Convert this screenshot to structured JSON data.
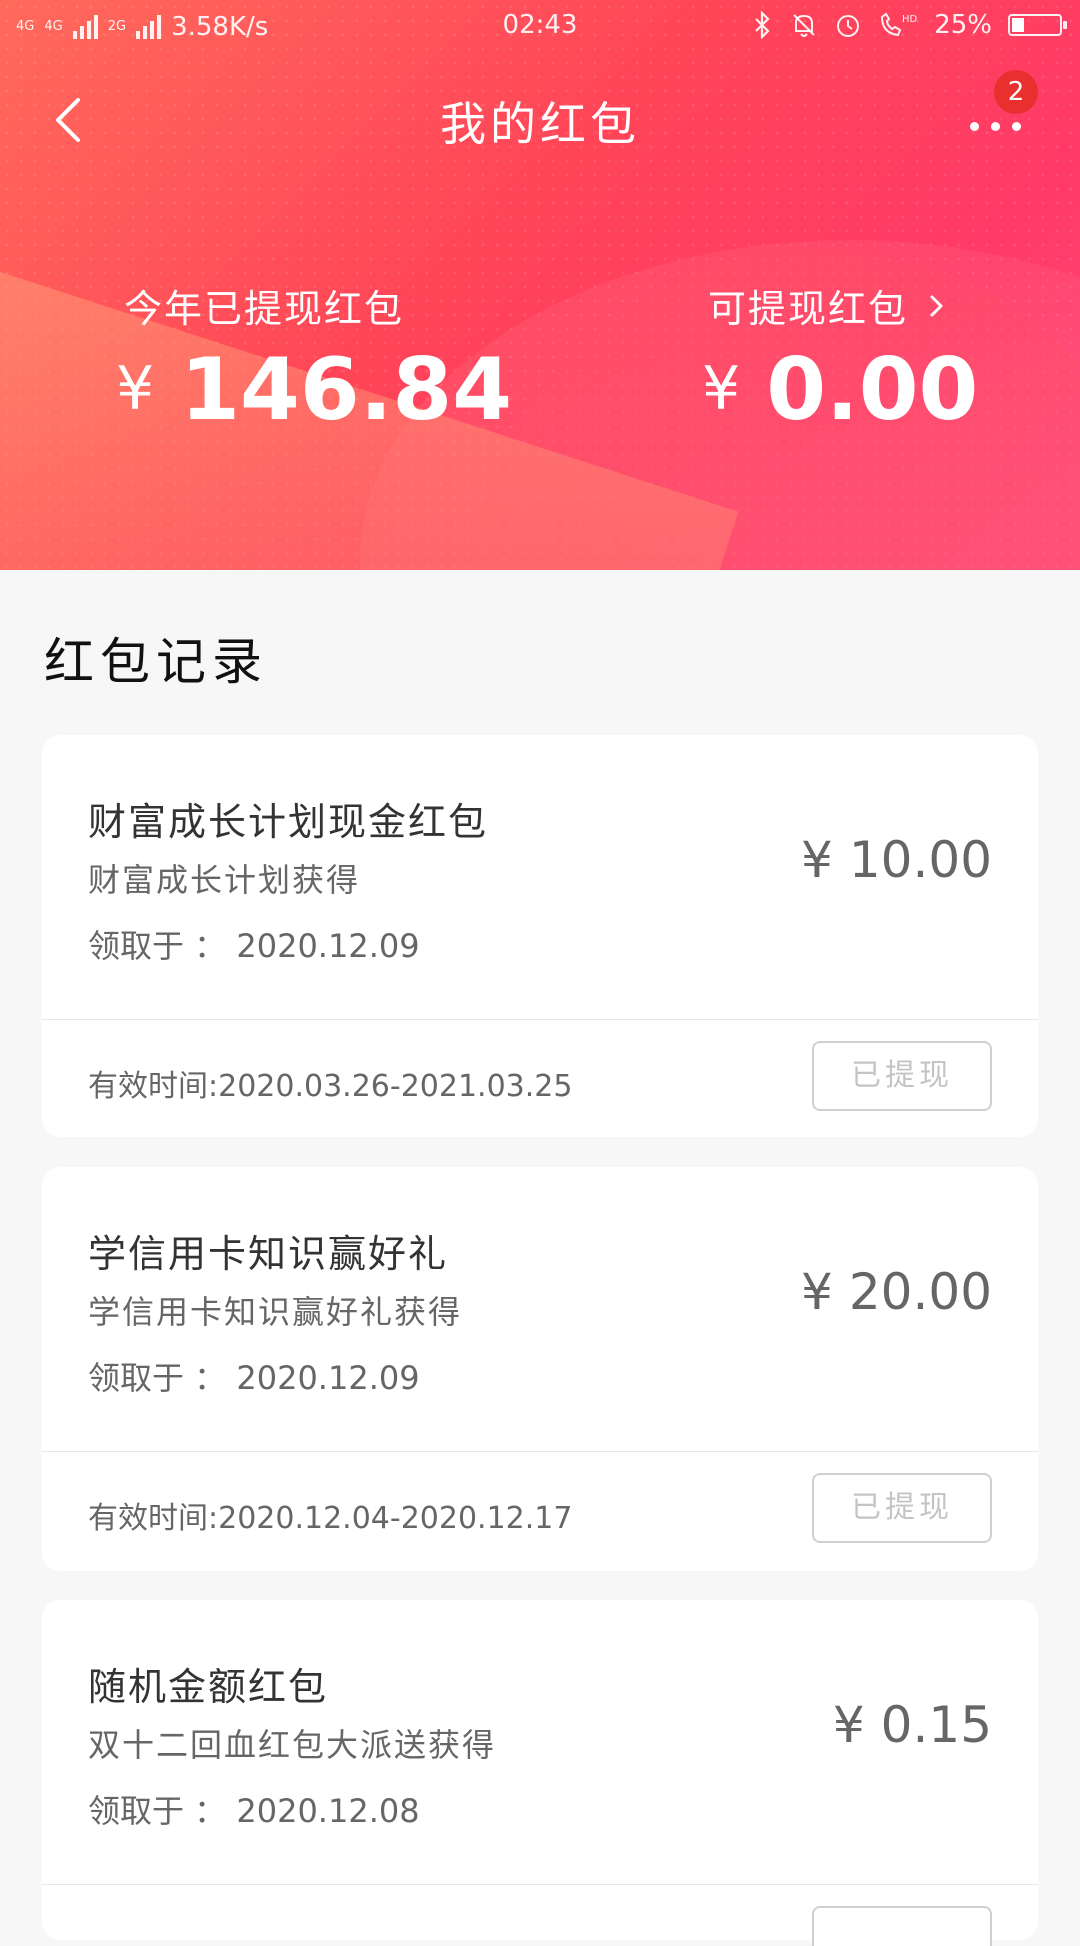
{
  "status_bar": {
    "network_left": "4G",
    "network_mid": "4G",
    "network_2g": "2G",
    "speed": "3.58K/s",
    "time": "02:43",
    "battery": "25%",
    "battery_level": 0.25,
    "icons": [
      "bluetooth-icon",
      "mute-bell-icon",
      "alarm-icon",
      "hd-call-icon"
    ]
  },
  "nav": {
    "title": "我的红包",
    "badge": "2"
  },
  "summary": {
    "left_label": "今年已提现红包",
    "left_currency": "¥",
    "left_value": "146.84",
    "right_label": "可提现红包",
    "right_currency": "¥",
    "right_value": "0.00"
  },
  "section_title": "红包记录",
  "records": [
    {
      "title": "财富成长计划现金红包",
      "source": "财富成长计划获得",
      "date_label": "领取于 ：",
      "date": "2020.12.09",
      "currency": "¥",
      "amount": "10.00",
      "valid": "有效时间:2020.03.26-2021.03.25",
      "status": "已提现"
    },
    {
      "title": "学信用卡知识赢好礼",
      "source": "学信用卡知识赢好礼获得",
      "date_label": "领取于 ：",
      "date": "2020.12.09",
      "currency": "¥",
      "amount": "20.00",
      "valid": "有效时间:2020.12.04-2020.12.17",
      "status": "已提现"
    },
    {
      "title": "随机金额红包",
      "source": "双十二回血红包大派送获得",
      "date_label": "领取于 ：",
      "date": "2020.12.08",
      "currency": "¥",
      "amount": "0.15",
      "valid": "",
      "status": ""
    }
  ],
  "colors": {
    "header_start": "#ff6a5b",
    "header_end": "#ff4a7e",
    "badge": "#e8302f",
    "background": "#f7f7f7"
  }
}
